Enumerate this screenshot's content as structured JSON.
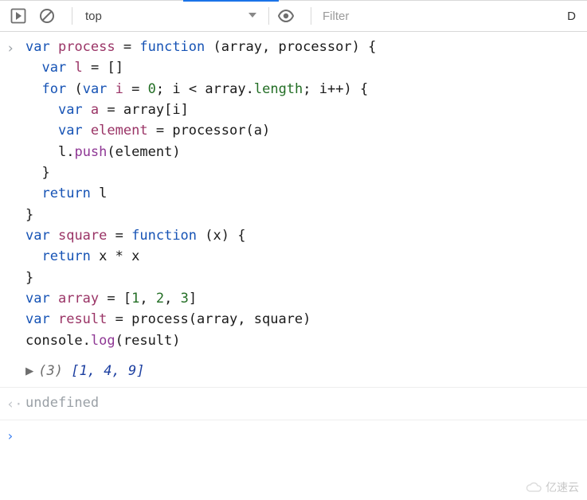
{
  "toolbar": {
    "context": "top",
    "filter_placeholder": "Filter",
    "right_char": "D"
  },
  "code": {
    "l1": "var process = function (array, processor) {",
    "l2": "  var l = []",
    "l3": "  for (var i = 0; i < array.length; i++) {",
    "l4": "    var a = array[i]",
    "l5": "    var element = processor(a)",
    "l6": "    l.push(element)",
    "l7": "  }",
    "l8": "  return l",
    "l9": "}",
    "l10": "var square = function (x) {",
    "l11": "  return x * x",
    "l12": "}",
    "l13": "var array = [1, 2, 3]",
    "l14": "var result = process(array, square)",
    "l15": "console.log(result)"
  },
  "output": {
    "count": "(3)",
    "array_text": "[1, 4, 9]",
    "values": [
      1,
      4,
      9
    ]
  },
  "return_value": "undefined",
  "watermark": "亿速云"
}
